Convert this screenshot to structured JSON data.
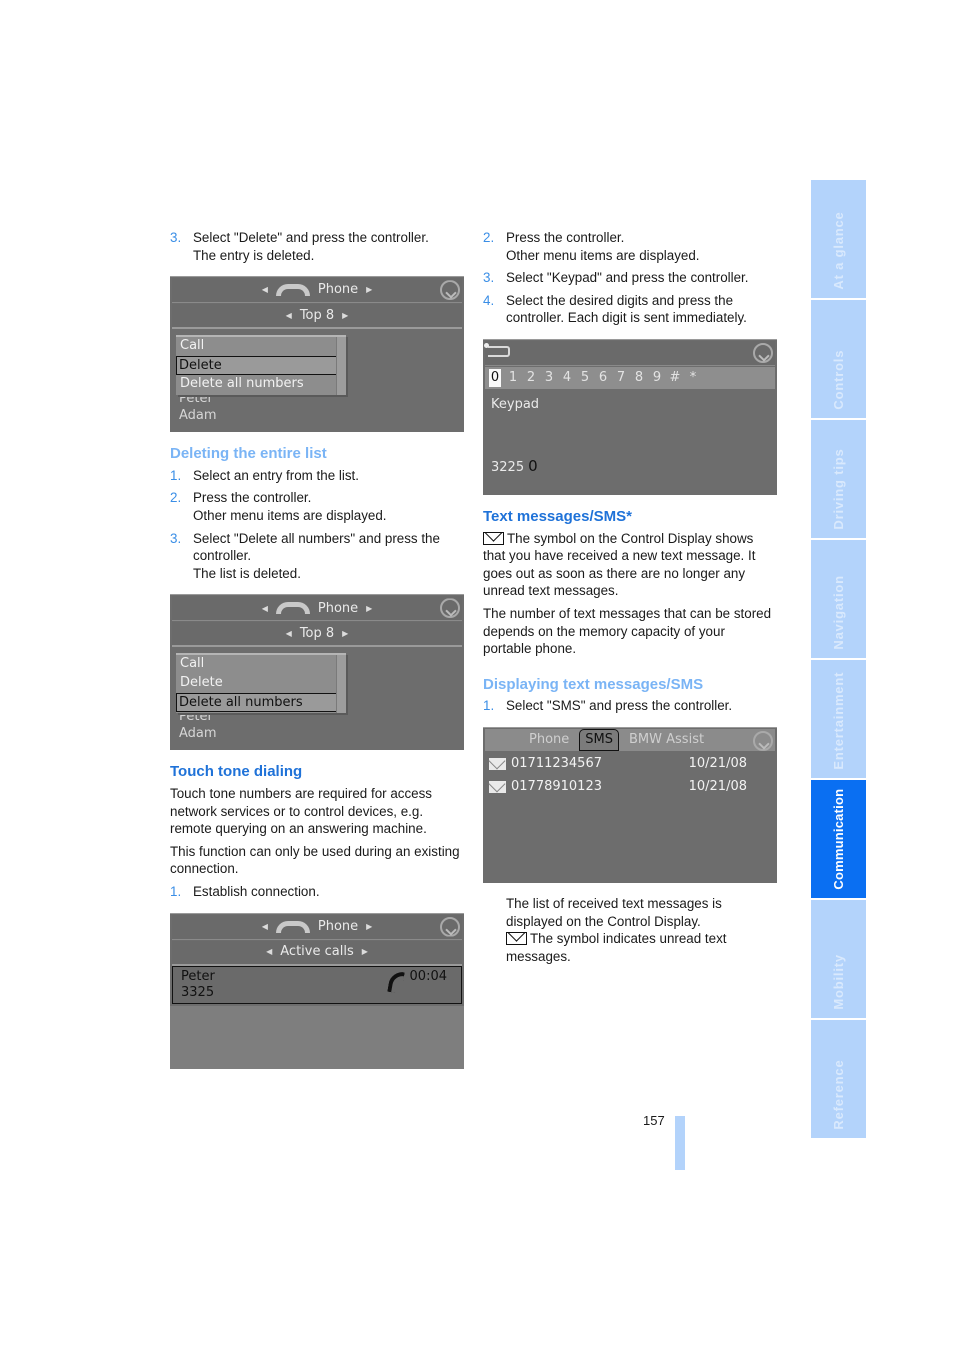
{
  "left_column": {
    "step_delete": {
      "num": "3.",
      "lines": [
        "Select \"Delete\" and press the controller.",
        "The entry is deleted."
      ]
    },
    "screen1": {
      "title": "Phone",
      "subtitle": "Top 8",
      "menu": [
        "Call",
        "Delete",
        "Delete all numbers"
      ],
      "selected_index": 1,
      "under_list": [
        "Peter",
        "Adam"
      ]
    },
    "section_delete_all": {
      "heading": "Deleting the entire list",
      "steps": [
        {
          "num": "1.",
          "lines": [
            "Select an entry from the list."
          ]
        },
        {
          "num": "2.",
          "lines": [
            "Press the controller.",
            "Other menu items are displayed."
          ]
        },
        {
          "num": "3.",
          "lines": [
            "Select \"Delete all numbers\" and press the controller.",
            "The list is deleted."
          ]
        }
      ]
    },
    "screen2": {
      "title": "Phone",
      "subtitle": "Top 8",
      "menu": [
        "Call",
        "Delete",
        "Delete all numbers"
      ],
      "selected_index": 2,
      "under_list": [
        "Peter",
        "Adam"
      ]
    },
    "section_touch_tone": {
      "heading": "Touch tone dialing",
      "paragraphs": [
        "Touch tone numbers are required for access network services or to control devices, e.g. remote querying on an answering machine.",
        "This function can only be used during an existing connection."
      ],
      "steps": [
        {
          "num": "1.",
          "lines": [
            "Establish connection."
          ]
        }
      ]
    },
    "screen3": {
      "title": "Phone",
      "subtitle": "Active calls",
      "caller": "Peter",
      "number": "3325",
      "duration": "00:04"
    }
  },
  "right_column": {
    "steps_top": [
      {
        "num": "2.",
        "lines": [
          "Press the controller.",
          "Other menu items are displayed."
        ]
      },
      {
        "num": "3.",
        "lines": [
          "Select \"Keypad\" and press the controller."
        ]
      },
      {
        "num": "4.",
        "lines": [
          "Select the desired digits and press the controller. Each digit is sent immediately."
        ]
      }
    ],
    "screen_keypad": {
      "keys": [
        "0",
        "1",
        "2",
        "3",
        "4",
        "5",
        "6",
        "7",
        "8",
        "9",
        "#",
        "*"
      ],
      "selected_key": "0",
      "label": "Keypad",
      "entered": "3225",
      "cursor_digit": "0"
    },
    "section_sms": {
      "heading": "Text messages/SMS*",
      "paragraphs": [
        "The symbol on the Control Display shows that you have received a new text message. It goes out as soon as there are no longer any unread text messages.",
        "The number of text messages that can be stored depends on the memory capacity of your portable phone."
      ]
    },
    "section_display_sms": {
      "heading": "Displaying text messages/SMS",
      "steps": [
        {
          "num": "1.",
          "lines": [
            "Select \"SMS\" and press the controller."
          ]
        }
      ]
    },
    "screen_sms": {
      "tabs": [
        "Phone",
        "SMS",
        "BMW Assist"
      ],
      "selected_tab": "SMS",
      "messages": [
        {
          "icon": "envelope-unread-icon",
          "number": "01711234567",
          "date": "10/21/08"
        },
        {
          "icon": "envelope-read-icon",
          "number": "01778910123",
          "date": "10/21/08"
        }
      ]
    },
    "after_sms": [
      "The list of received text messages is displayed on the Control Display.",
      "The symbol indicates unread text messages."
    ]
  },
  "sidebar_tabs": [
    {
      "label": "At a glance",
      "active": false
    },
    {
      "label": "Controls",
      "active": false
    },
    {
      "label": "Driving tips",
      "active": false
    },
    {
      "label": "Navigation",
      "active": false
    },
    {
      "label": "Entertainment",
      "active": false
    },
    {
      "label": "Communication",
      "active": true
    },
    {
      "label": "Mobility",
      "active": false
    },
    {
      "label": "Reference",
      "active": false
    }
  ],
  "page_number": "157",
  "colors": {
    "accent": "#1f72d8",
    "accent_light": "#7ab4f5",
    "tab": "#b3d3fb",
    "tab_active": "#0a6ff2"
  }
}
